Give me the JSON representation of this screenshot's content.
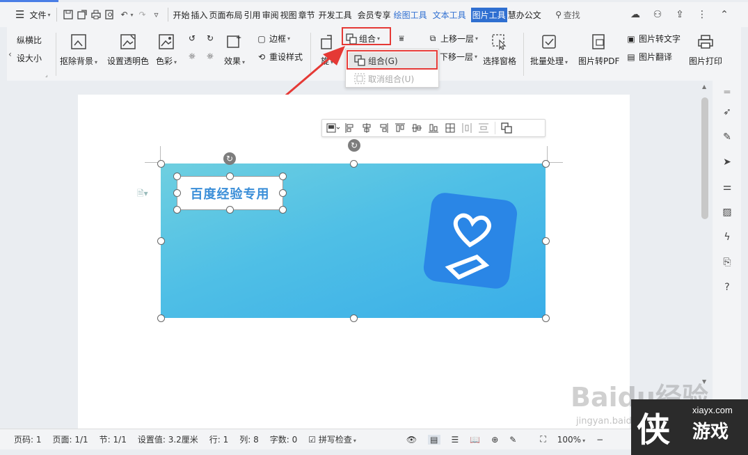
{
  "menu": {
    "file_label": "文件",
    "tabs": [
      {
        "label": "开始"
      },
      {
        "label": "插入"
      },
      {
        "label": "页面布局"
      },
      {
        "label": "引用"
      },
      {
        "label": "审阅"
      },
      {
        "label": "视图"
      },
      {
        "label": "章节"
      },
      {
        "label": "开发工具"
      },
      {
        "label": "会员专享"
      },
      {
        "label": "绘图工具"
      },
      {
        "label": "文本工具"
      },
      {
        "label": "图片工具"
      },
      {
        "label": "慧办公文"
      }
    ],
    "search_label": "查找"
  },
  "ribbon": {
    "left_cut_1": "纵横比",
    "left_cut_2": "设大小",
    "remove_bg": "抠除背景",
    "set_transparent": "设置透明色",
    "color": "色彩",
    "effects": "效果",
    "border": "边框",
    "reset_style": "重设样式",
    "rotate_cut": "旋",
    "group": "组合",
    "move_up": "上移一层",
    "move_down": "下移一层",
    "select_pane": "选择窗格",
    "batch": "批量处理",
    "to_pdf": "图片转PDF",
    "to_text": "图片转文字",
    "translate": "图片翻译",
    "print": "图片打印"
  },
  "dropdown": {
    "group_item": "组合(G)",
    "ungroup_item": "取消组合(U)"
  },
  "document": {
    "textbox_text": "百度经验专用"
  },
  "status": {
    "page_code": "页码: 1",
    "pages": "页面: 1/1",
    "section": "节: 1/1",
    "setting": "设置值: 3.2厘米",
    "row": "行: 1",
    "col": "列: 8",
    "words": "字数: 0",
    "spell": "拼写检查",
    "zoom": "100%"
  },
  "watermark": {
    "baidu": "Baidu经验",
    "jingyan": "jingyan.baidu.com",
    "brand_char": "侠",
    "brand_domain": "xiayx.com",
    "brand_name": "游戏"
  },
  "colors": {
    "accent": "#2f6fd1",
    "highlight": "#e53935",
    "banner_start": "#6ecfe0",
    "banner_end": "#3aaee8",
    "logo": "#2a86e6"
  }
}
